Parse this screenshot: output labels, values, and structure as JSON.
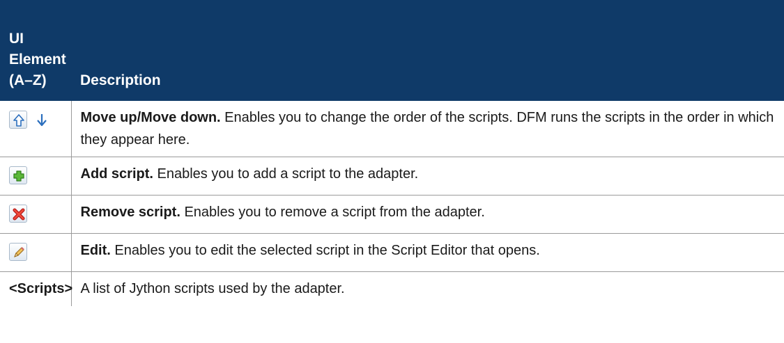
{
  "table": {
    "headers": [
      "UI Element (A–Z)",
      "Description"
    ],
    "header_lines": [
      "UI",
      "Element",
      "(A–Z)"
    ],
    "rows": [
      {
        "icons": [
          "move-up-icon",
          "move-down-icon"
        ],
        "term": "Move up/Move down.",
        "desc": " Enables you to change the order of the scripts. DFM runs the scripts in the order in which they appear here."
      },
      {
        "icons": [
          "add-icon"
        ],
        "term": "Add script.",
        "desc": " Enables you to add a script to the adapter."
      },
      {
        "icons": [
          "remove-icon"
        ],
        "term": "Remove script.",
        "desc": " Enables you to remove a script from the adapter."
      },
      {
        "icons": [
          "edit-pencil-icon"
        ],
        "term": "Edit.",
        "desc": " Enables you to edit the selected script in the Script Editor that opens."
      },
      {
        "element_text": "<Scripts>",
        "desc": "A list of Jython scripts used by the adapter."
      }
    ]
  },
  "colors": {
    "header_bg": "#0f3a68",
    "header_text": "#ffffff",
    "rule": "#9a9a9a"
  }
}
